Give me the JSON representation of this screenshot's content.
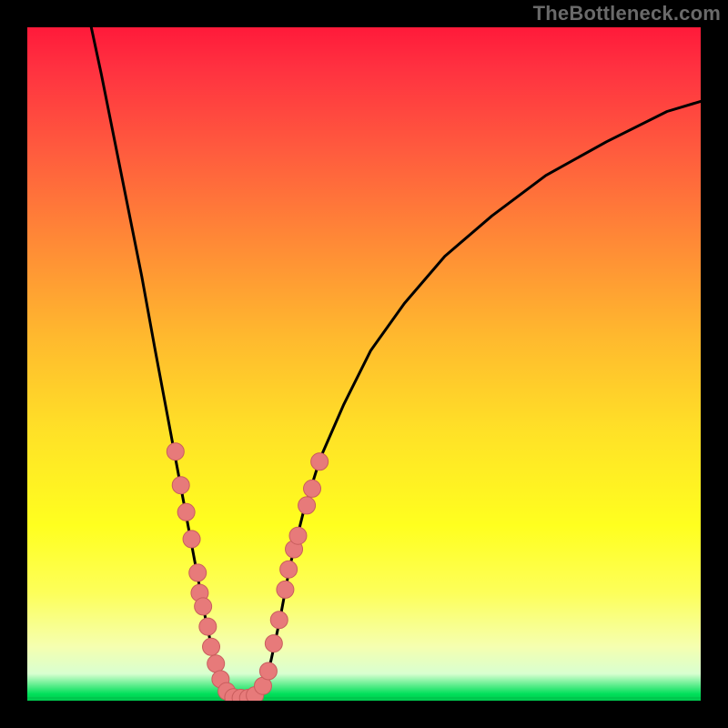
{
  "watermark": "TheBottleneck.com",
  "colors": {
    "curve_stroke": "#000000",
    "marker_fill": "#e77a7a",
    "marker_stroke": "#c95d5d",
    "bottom_band_stroke": "#00c84e"
  },
  "chart_data": {
    "type": "line",
    "title": "",
    "xlabel": "",
    "ylabel": "",
    "xlim": [
      0,
      100
    ],
    "ylim": [
      0,
      100
    ],
    "grid": false,
    "legend": false,
    "curve": [
      {
        "x": 9.5,
        "y": 100
      },
      {
        "x": 11,
        "y": 93
      },
      {
        "x": 13,
        "y": 83
      },
      {
        "x": 15,
        "y": 73
      },
      {
        "x": 17,
        "y": 63
      },
      {
        "x": 19,
        "y": 52
      },
      {
        "x": 20.5,
        "y": 44
      },
      {
        "x": 22,
        "y": 36
      },
      {
        "x": 23.5,
        "y": 28
      },
      {
        "x": 25,
        "y": 20
      },
      {
        "x": 26.5,
        "y": 12
      },
      {
        "x": 27.8,
        "y": 6
      },
      {
        "x": 29,
        "y": 2
      },
      {
        "x": 30.5,
        "y": 0.3
      },
      {
        "x": 32,
        "y": 0.3
      },
      {
        "x": 33.5,
        "y": 0.3
      },
      {
        "x": 35,
        "y": 2
      },
      {
        "x": 36.2,
        "y": 6
      },
      {
        "x": 37.5,
        "y": 12
      },
      {
        "x": 39,
        "y": 20
      },
      {
        "x": 41,
        "y": 28
      },
      {
        "x": 43.5,
        "y": 36
      },
      {
        "x": 47,
        "y": 44
      },
      {
        "x": 51,
        "y": 52
      },
      {
        "x": 56,
        "y": 59
      },
      {
        "x": 62,
        "y": 66
      },
      {
        "x": 69,
        "y": 72
      },
      {
        "x": 77,
        "y": 78
      },
      {
        "x": 86,
        "y": 83
      },
      {
        "x": 95,
        "y": 87.5
      },
      {
        "x": 100,
        "y": 89
      }
    ],
    "markers": [
      {
        "x": 22.0,
        "y": 37
      },
      {
        "x": 22.8,
        "y": 32
      },
      {
        "x": 23.6,
        "y": 28
      },
      {
        "x": 24.4,
        "y": 24
      },
      {
        "x": 25.3,
        "y": 19
      },
      {
        "x": 25.6,
        "y": 16
      },
      {
        "x": 26.1,
        "y": 14
      },
      {
        "x": 26.8,
        "y": 11
      },
      {
        "x": 27.3,
        "y": 8
      },
      {
        "x": 28.0,
        "y": 5.5
      },
      {
        "x": 28.7,
        "y": 3.2
      },
      {
        "x": 29.6,
        "y": 1.4
      },
      {
        "x": 30.6,
        "y": 0.5
      },
      {
        "x": 31.7,
        "y": 0.4
      },
      {
        "x": 32.8,
        "y": 0.4
      },
      {
        "x": 33.8,
        "y": 0.8
      },
      {
        "x": 35.0,
        "y": 2.2
      },
      {
        "x": 35.8,
        "y": 4.4
      },
      {
        "x": 36.6,
        "y": 8.5
      },
      {
        "x": 37.4,
        "y": 12
      },
      {
        "x": 38.3,
        "y": 16.5
      },
      {
        "x": 38.8,
        "y": 19.5
      },
      {
        "x": 39.6,
        "y": 22.5
      },
      {
        "x": 40.2,
        "y": 24.5
      },
      {
        "x": 41.5,
        "y": 29
      },
      {
        "x": 42.3,
        "y": 31.5
      },
      {
        "x": 43.4,
        "y": 35.5
      }
    ]
  }
}
